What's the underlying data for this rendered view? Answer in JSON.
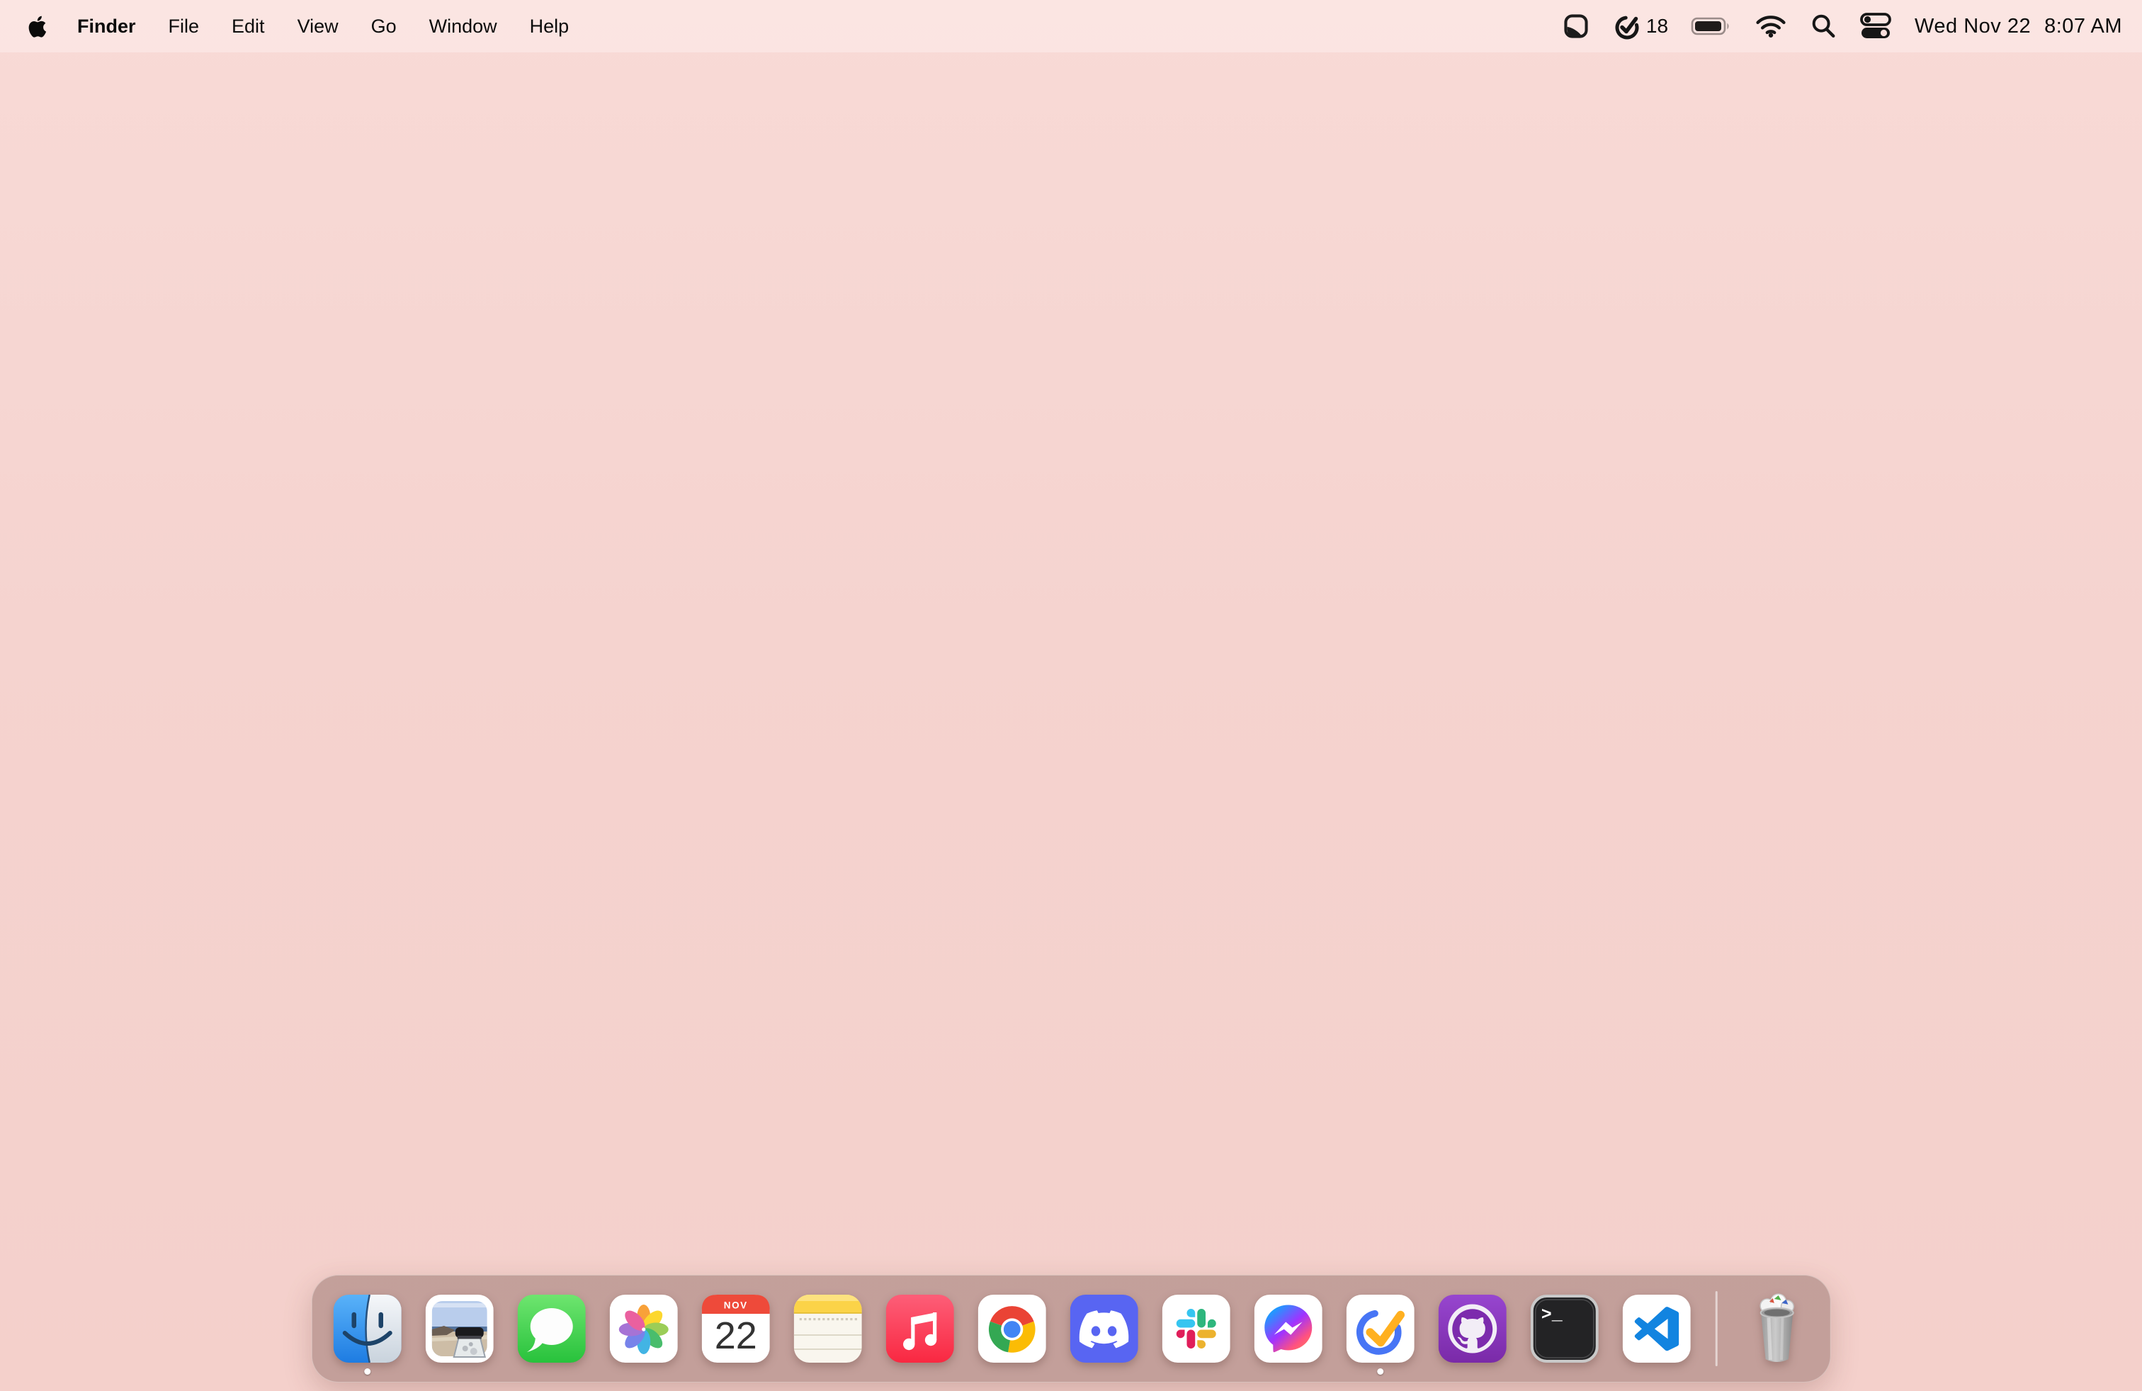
{
  "desktop": {
    "wallpaper_color": "#f5d3cf"
  },
  "menu_bar": {
    "menus": [
      {
        "label": "Finder",
        "bold": true
      },
      {
        "label": "File"
      },
      {
        "label": "Edit"
      },
      {
        "label": "View"
      },
      {
        "label": "Go"
      },
      {
        "label": "Window"
      },
      {
        "label": "Help"
      }
    ],
    "status": {
      "icons": [
        "sticky-note",
        "ticktick-check",
        "battery-full",
        "wifi",
        "spotlight-search",
        "control-center"
      ],
      "task_count": "18",
      "clock_date": "Wed Nov 22",
      "clock_time": "8:07 AM"
    }
  },
  "dock": {
    "calendar": {
      "month": "NOV",
      "day": "22"
    },
    "terminal_prompt": ">_",
    "apps": [
      {
        "name": "Finder",
        "running": true
      },
      {
        "name": "Preview",
        "running": false
      },
      {
        "name": "Messages",
        "running": false
      },
      {
        "name": "Photos",
        "running": false
      },
      {
        "name": "Calendar",
        "running": false
      },
      {
        "name": "Notes",
        "running": false
      },
      {
        "name": "Music",
        "running": false
      },
      {
        "name": "Google Chrome",
        "running": false
      },
      {
        "name": "Discord",
        "running": false
      },
      {
        "name": "Slack",
        "running": false
      },
      {
        "name": "Messenger",
        "running": false
      },
      {
        "name": "TickTick",
        "running": true
      },
      {
        "name": "GitHub Desktop",
        "running": false
      },
      {
        "name": "Terminal",
        "running": false
      },
      {
        "name": "Visual Studio Code",
        "running": false
      },
      {
        "name": "Trash",
        "running": false
      }
    ]
  },
  "colors": {
    "wallpaper": "#f5d3cf",
    "menu_bar": "rgba(255,241,239,0.48)",
    "dock_bg": "rgba(96,62,56,0.33)",
    "ticktick_blue": "#4775f5",
    "ticktick_check": "#ffb020",
    "discord_blurple": "#5865F2",
    "github_purple": "#8a33c0",
    "chrome_red": "#EA4335",
    "chrome_yellow": "#FBBC05",
    "chrome_green": "#34A853",
    "chrome_blue": "#4285F4",
    "slack_blue": "#36C5F0",
    "slack_green": "#2EB67D",
    "slack_yellow": "#ECB22E",
    "slack_pink": "#E01E5A",
    "messages_green": "#2cc840",
    "music_red": "#fa2b45",
    "calendar_red": "#ee4a3a",
    "notes_yellow": "#fbd348"
  }
}
